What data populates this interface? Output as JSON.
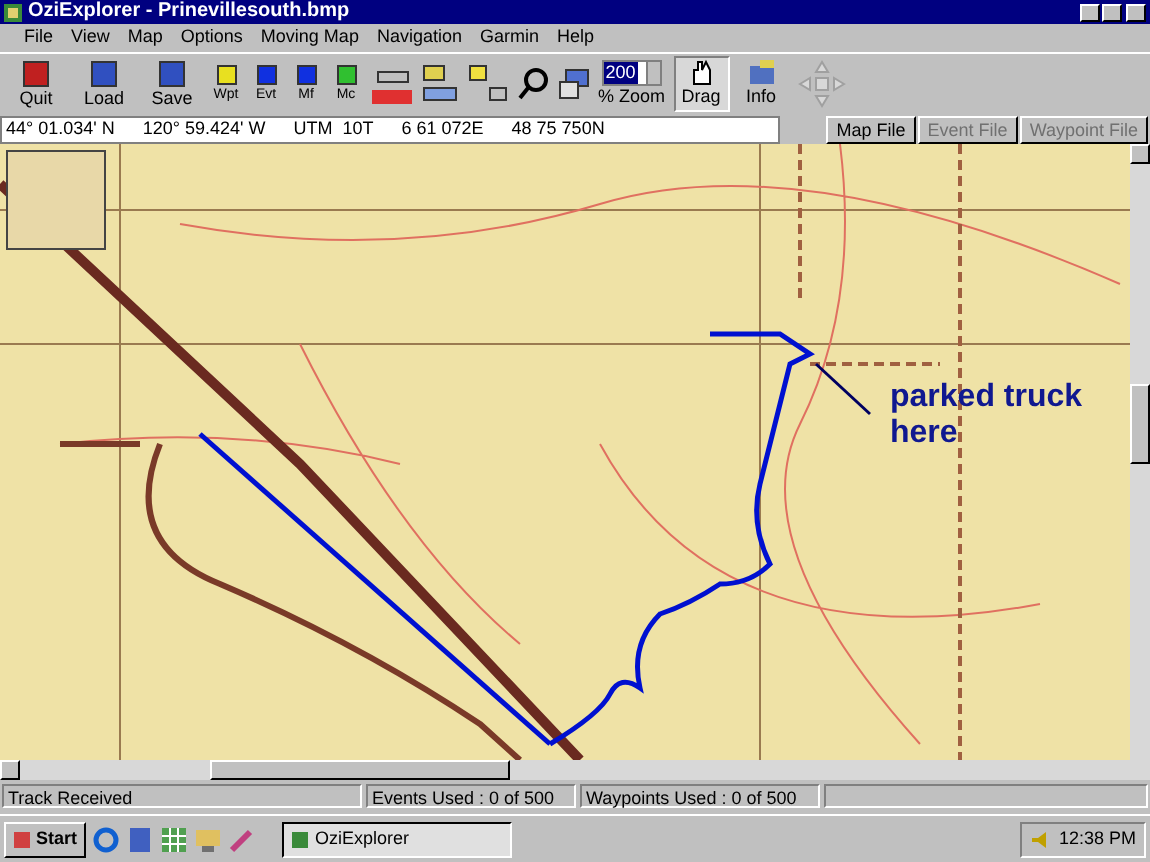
{
  "window": {
    "title": "OziExplorer - Prinevillesouth.bmp"
  },
  "menu": [
    {
      "label": "File"
    },
    {
      "label": "View"
    },
    {
      "label": "Map"
    },
    {
      "label": "Options"
    },
    {
      "label": "Moving Map"
    },
    {
      "label": "Navigation"
    },
    {
      "label": "Garmin"
    },
    {
      "label": "Help"
    }
  ],
  "toolbar": [
    {
      "label": "Quit",
      "kind": "big"
    },
    {
      "label": "Load",
      "kind": "big"
    },
    {
      "label": "Save",
      "kind": "big"
    },
    {
      "label": "Wpt",
      "kind": "small"
    },
    {
      "label": "Evt",
      "kind": "small"
    },
    {
      "label": "Mf",
      "kind": "small"
    },
    {
      "label": "Mc",
      "kind": "small"
    }
  ],
  "zoom": {
    "value": "200",
    "label": "% Zoom"
  },
  "tools": [
    {
      "label": "Drag",
      "selected": true
    },
    {
      "label": "Info",
      "selected": false
    }
  ],
  "position": [
    "44° 01.034' N",
    "120° 59.424' W",
    "UTM  10T",
    "6 61 072E",
    "48 75 750N"
  ],
  "file_buttons": [
    {
      "label": "Map File",
      "disabled": false
    },
    {
      "label": "Event File",
      "disabled": true
    },
    {
      "label": "Waypoint File",
      "disabled": true
    }
  ],
  "map": {
    "annotation": "parked truck here"
  },
  "status_bar": [
    "Track Received",
    "Events Used : 0 of 500",
    "Waypoints Used : 0 of 500"
  ],
  "taskbar": {
    "start": "Start",
    "tasks": [
      {
        "label": "OziExplorer",
        "selected": true
      }
    ],
    "clock": "12:38 PM"
  }
}
